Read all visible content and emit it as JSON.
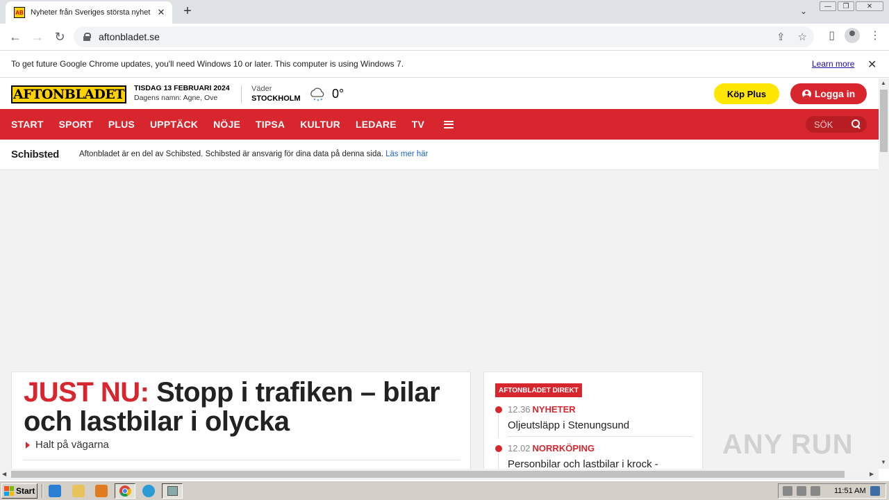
{
  "browser": {
    "tab_title": "Nyheter från Sveriges största nyhet",
    "tab_favicon_text": "AB",
    "tab_close": "✕",
    "new_tab": "+",
    "url": "aftonbladet.se",
    "window_buttons": [
      "—",
      "❐",
      "✕"
    ]
  },
  "infobar": {
    "message": "To get future Google Chrome updates, you'll need Windows 10 or later. This computer is using Windows 7.",
    "link": "Learn more",
    "close": "✕"
  },
  "site": {
    "logo_text": "AFTONBLADET",
    "date": "TISDAG 13 FEBRUARI 2024",
    "names": "Dagens namn: Agne, Ove",
    "weather_label": "Väder",
    "weather_city": "STOCKHOLM",
    "temperature": "0°",
    "buy_plus": "Köp Plus",
    "login": "Logga in",
    "nav": [
      "START",
      "SPORT",
      "PLUS",
      "UPPTÄCK",
      "NÖJE",
      "TIPSA",
      "KULTUR",
      "LEDARE",
      "TV"
    ],
    "search_label": "SÖK",
    "schibsted_logo": "Schibsted",
    "schibsted_text": "Aftonbladet är en del av Schibsted. Schibsted är ansvarig för dina data på denna sida.",
    "schibsted_link": "Läs mer här",
    "brand_red": "#d7262e",
    "brand_yellow": "#ffd200"
  },
  "main_story": {
    "prefix": "JUST NU:",
    "headline": "Stopp i trafiken – bilar och lastbilar i olycka",
    "subhead": "Halt på vägarna"
  },
  "direkt": {
    "badge": "AFTONBLADET DIREKT",
    "items": [
      {
        "time": "12.36",
        "category": "NYHETER",
        "title": "Oljeutsläpp i Stenungsund"
      },
      {
        "time": "12.02",
        "category": "NORRKÖPING",
        "title": "Personbilar och lastbilar i krock -"
      }
    ]
  },
  "watermark": "ANY RUN",
  "taskbar": {
    "start": "Start",
    "clock": "11:51 AM"
  }
}
